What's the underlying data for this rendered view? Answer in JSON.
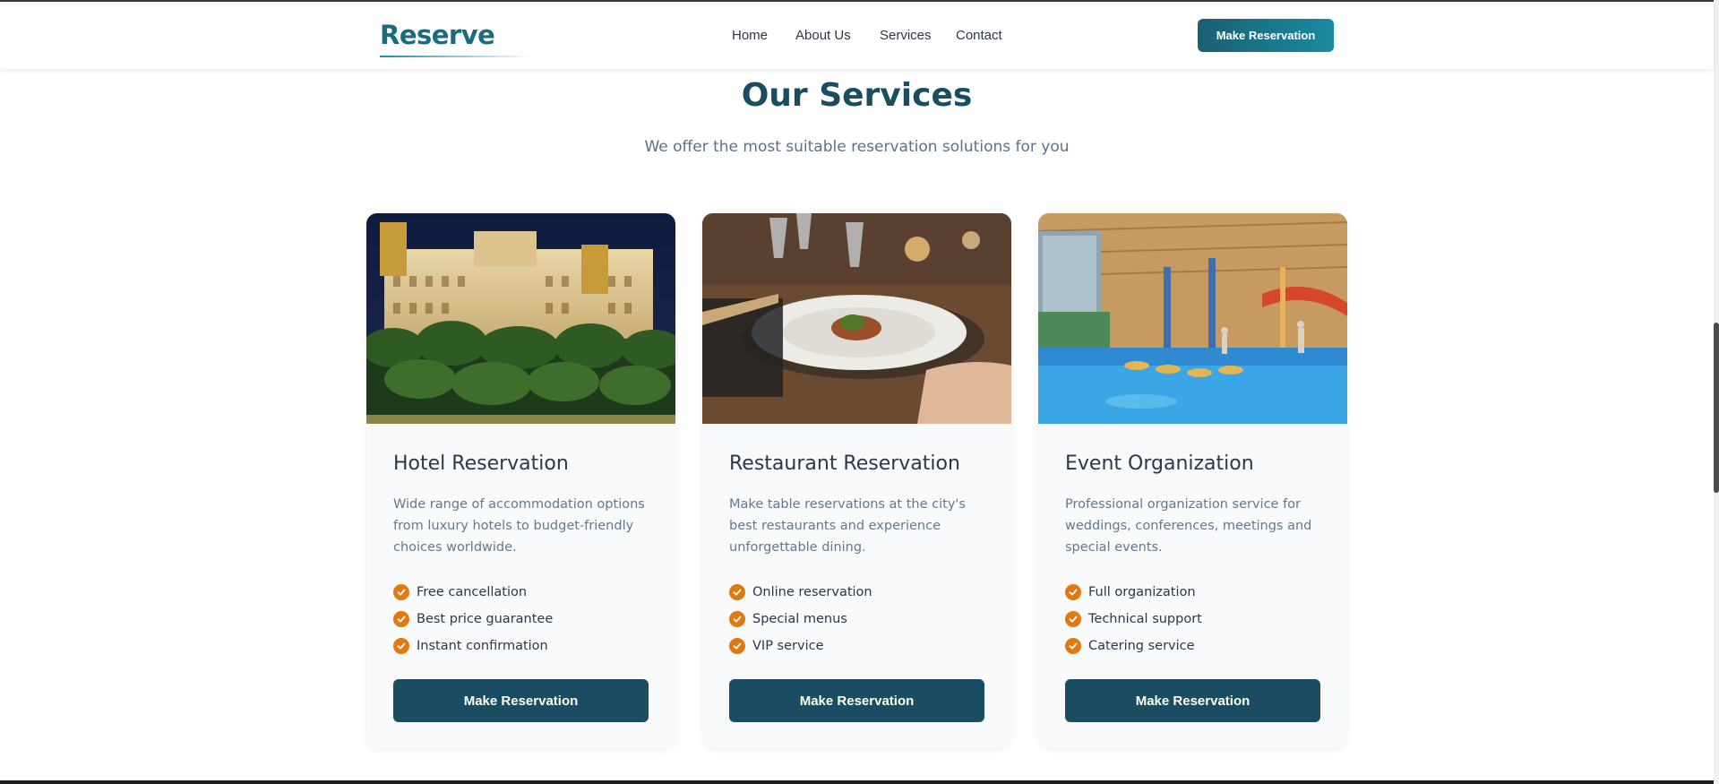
{
  "header": {
    "logo": "Reserve",
    "nav": [
      {
        "label": "Home"
      },
      {
        "label": "About Us"
      },
      {
        "label": "Services"
      },
      {
        "label": "Contact"
      }
    ],
    "cta_label": "Make Reservation"
  },
  "section": {
    "title": "Our Services",
    "subtitle": "We offer the most suitable reservation solutions for you"
  },
  "cards": [
    {
      "title": "Hotel Reservation",
      "description": "Wide range of accommodation options from luxury hotels to budget-friendly choices worldwide.",
      "features": [
        "Free cancellation",
        "Best price guarantee",
        "Instant confirmation"
      ],
      "button": "Make Reservation"
    },
    {
      "title": "Restaurant Reservation",
      "description": "Make table reservations at the city's best restaurants and experience unforgettable dining.",
      "features": [
        "Online reservation",
        "Special menus",
        "VIP service"
      ],
      "button": "Make Reservation"
    },
    {
      "title": "Event Organization",
      "description": "Professional organization service for weddings, conferences, meetings and special events.",
      "features": [
        "Full organization",
        "Technical support",
        "Catering service"
      ],
      "button": "Make Reservation"
    }
  ],
  "colors": {
    "primary": "#1a4d61",
    "accent": "#e07a10",
    "logo": "#1a6b7c"
  },
  "icons": {
    "feature": "check-circle-icon"
  }
}
